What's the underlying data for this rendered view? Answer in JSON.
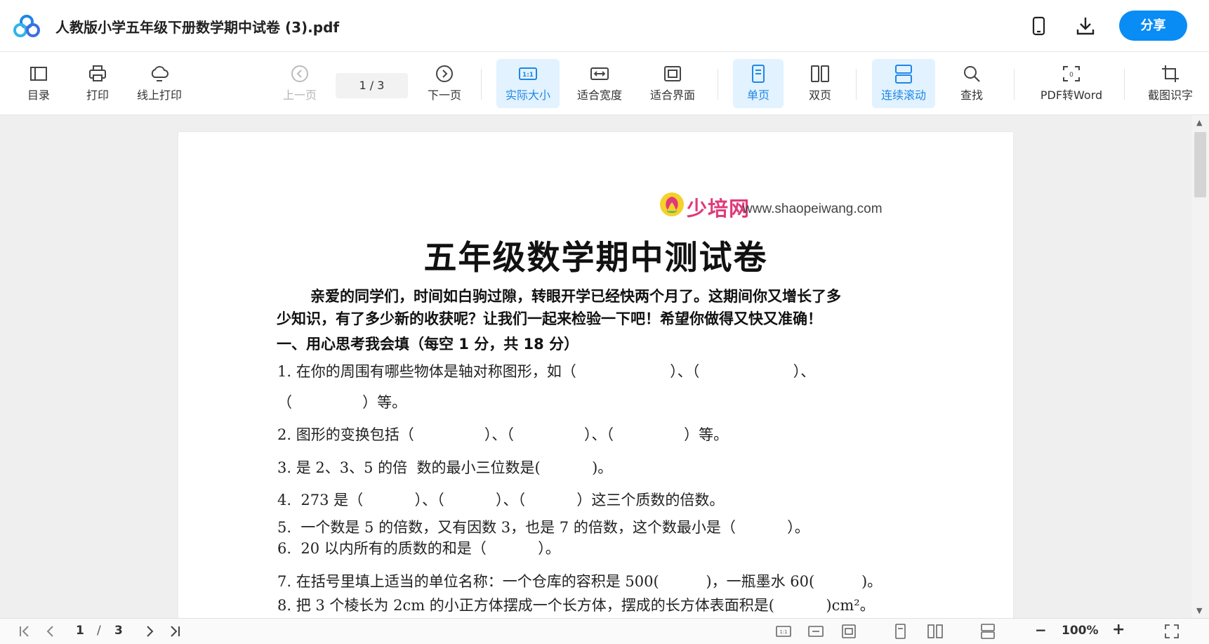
{
  "header": {
    "title": "人教版小学五年级下册数学期中试卷 (3).pdf",
    "share_label": "分享",
    "icons": [
      "app-logo-icon",
      "mobile-icon",
      "download-icon"
    ]
  },
  "toolbar": {
    "toc": "目录",
    "print": "打印",
    "online_print": "线上打印",
    "prev_page": "上一页",
    "page_indicator": "1  /  3",
    "next_page": "下一页",
    "actual_size": "实际大小",
    "fit_width": "适合宽度",
    "fit_screen": "适合界面",
    "single_page": "单页",
    "double_page": "双页",
    "continuous_scroll": "连续滚动",
    "find": "查找",
    "pdf_to_word": "PDF转Word",
    "screenshot_ocr": "截图识字"
  },
  "document": {
    "site_logo_cn": "少培网",
    "site_url": "www.shaopeiwang.com",
    "heading": "五年级数学期中测试卷",
    "intro_line1": "亲爱的同学们，时间如白驹过隙，转眼开学已经快两个月了。这期间你又增长了多",
    "intro_line2": "少知识，有了多少新的收获呢？让我们一起来检验一下吧！希望你做得又快又准确！",
    "section1": "一、用心思考我会填（每空 1 分，共 18 分）",
    "questions": [
      "1. 在你的周围有哪些物体是轴对称图形，如（                    ）、（                    ）、",
      "（               ）等。",
      "2. 图形的变换包括（               ）、（               ）、（               ）等。",
      "3. 是 2、3、5 的倍  数的最小三位数是(           )。",
      "4.  273 是（           ）、（           ）、（           ）这三个质数的倍数。",
      "5.  一个数是 5 的倍数，又有因数 3，也是 7 的倍数，这个数最小是（           ）。",
      "6.  20 以内所有的质数的和是（           ）。",
      "7. 在括号里填上适当的单位名称：一个仓库的容积是 500(          )，一瓶墨水 60(          )。",
      "8. 把 3 个棱长为 2cm 的小正方体摆成一个长方体，摆成的长方体表面积是(           )cm²。"
    ]
  },
  "bottombar": {
    "current_page": "1",
    "page_sep": "/",
    "total_pages": "3",
    "zoom_minus": "−",
    "zoom": "100%",
    "zoom_plus": "+"
  },
  "colors": {
    "accent": "#0a8cf5",
    "active_bg": "#e3f2ff",
    "active_text": "#1e88e5",
    "logo_pink": "#e03a7a",
    "logo_green": "#3bb36a"
  }
}
